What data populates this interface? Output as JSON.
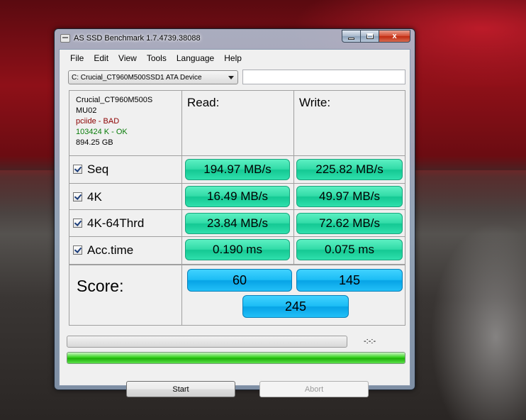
{
  "window": {
    "title": "AS SSD Benchmark 1.7.4739.38088",
    "close_glyph": "x"
  },
  "menu": [
    "File",
    "Edit",
    "View",
    "Tools",
    "Language",
    "Help"
  ],
  "device": {
    "selected": "C: Crucial_CT960M500SSD1 ATA Device",
    "model": "Crucial_CT960M500S",
    "firmware": "MU02",
    "driver": "pciide - BAD",
    "alignment": "103424 K - OK",
    "size": "894.25 GB"
  },
  "columns": {
    "read": "Read:",
    "write": "Write:"
  },
  "rows": [
    {
      "label": "Seq",
      "read": "194.97 MB/s",
      "write": "225.82 MB/s",
      "checked": true
    },
    {
      "label": "4K",
      "read": "16.49 MB/s",
      "write": "49.97 MB/s",
      "checked": true
    },
    {
      "label": "4K-64Thrd",
      "read": "23.84 MB/s",
      "write": "72.62 MB/s",
      "checked": true
    },
    {
      "label": "Acc.time",
      "read": "0.190 ms",
      "write": "0.075 ms",
      "checked": true
    }
  ],
  "score": {
    "label": "Score:",
    "read": "60",
    "write": "145",
    "total": "245"
  },
  "progress": {
    "time": "-:-:-",
    "main_fraction": 0.0,
    "overall_fraction": 1.0
  },
  "buttons": {
    "start": "Start",
    "abort": "Abort"
  },
  "colors": {
    "result_green": "#2fe0ad",
    "score_blue": "#1cbdf5",
    "progress_green": "#36d21e",
    "status_ok": "#0a7d0a",
    "status_bad": "#8b0000"
  }
}
